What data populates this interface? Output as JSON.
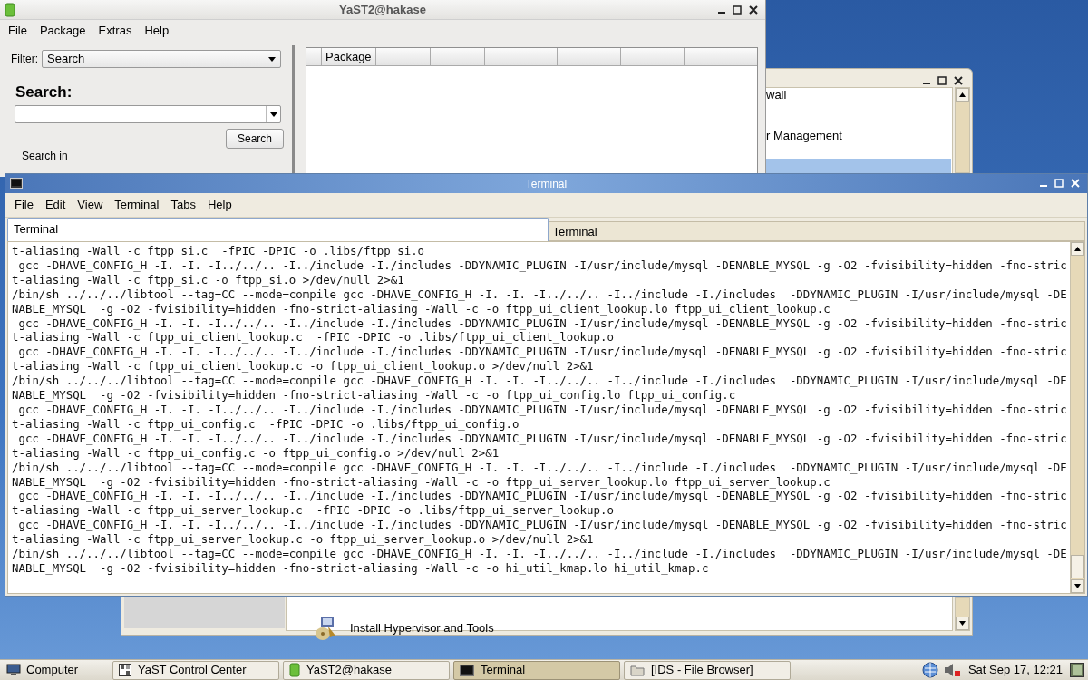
{
  "yast2_window": {
    "title": "YaST2@hakase",
    "menu": [
      "File",
      "Package",
      "Extras",
      "Help"
    ],
    "filter_label": "Filter:",
    "filter_value": "Search",
    "search_heading": "Search:",
    "search_button": "Search",
    "search_in_label": "Search in",
    "table_columns": [
      "Package"
    ]
  },
  "control_center_window": {
    "items": [
      "wall",
      "r Management"
    ],
    "bottom_item": "Install Hypervisor and Tools"
  },
  "terminal_window": {
    "title": "Terminal",
    "menu": [
      "File",
      "Edit",
      "View",
      "Terminal",
      "Tabs",
      "Help"
    ],
    "tabs": [
      {
        "label": "Terminal",
        "selected": true
      },
      {
        "label": "Terminal",
        "selected": false
      }
    ],
    "lines": [
      "t-aliasing -Wall -c ftpp_si.c  -fPIC -DPIC -o .libs/ftpp_si.o",
      " gcc -DHAVE_CONFIG_H -I. -I. -I../../.. -I../include -I./includes -DDYNAMIC_PLUGIN -I/usr/include/mysql -DENABLE_MYSQL -g -O2 -fvisibility=hidden -fno-stric",
      "t-aliasing -Wall -c ftpp_si.c -o ftpp_si.o >/dev/null 2>&1",
      "/bin/sh ../../../libtool --tag=CC --mode=compile gcc -DHAVE_CONFIG_H -I. -I. -I../../.. -I../include -I./includes  -DDYNAMIC_PLUGIN -I/usr/include/mysql -DE",
      "NABLE_MYSQL  -g -O2 -fvisibility=hidden -fno-strict-aliasing -Wall -c -o ftpp_ui_client_lookup.lo ftpp_ui_client_lookup.c",
      " gcc -DHAVE_CONFIG_H -I. -I. -I../../.. -I../include -I./includes -DDYNAMIC_PLUGIN -I/usr/include/mysql -DENABLE_MYSQL -g -O2 -fvisibility=hidden -fno-stric",
      "t-aliasing -Wall -c ftpp_ui_client_lookup.c  -fPIC -DPIC -o .libs/ftpp_ui_client_lookup.o",
      " gcc -DHAVE_CONFIG_H -I. -I. -I../../.. -I../include -I./includes -DDYNAMIC_PLUGIN -I/usr/include/mysql -DENABLE_MYSQL -g -O2 -fvisibility=hidden -fno-stric",
      "t-aliasing -Wall -c ftpp_ui_client_lookup.c -o ftpp_ui_client_lookup.o >/dev/null 2>&1",
      "/bin/sh ../../../libtool --tag=CC --mode=compile gcc -DHAVE_CONFIG_H -I. -I. -I../../.. -I../include -I./includes  -DDYNAMIC_PLUGIN -I/usr/include/mysql -DE",
      "NABLE_MYSQL  -g -O2 -fvisibility=hidden -fno-strict-aliasing -Wall -c -o ftpp_ui_config.lo ftpp_ui_config.c",
      " gcc -DHAVE_CONFIG_H -I. -I. -I../../.. -I../include -I./includes -DDYNAMIC_PLUGIN -I/usr/include/mysql -DENABLE_MYSQL -g -O2 -fvisibility=hidden -fno-stric",
      "t-aliasing -Wall -c ftpp_ui_config.c  -fPIC -DPIC -o .libs/ftpp_ui_config.o",
      " gcc -DHAVE_CONFIG_H -I. -I. -I../../.. -I../include -I./includes -DDYNAMIC_PLUGIN -I/usr/include/mysql -DENABLE_MYSQL -g -O2 -fvisibility=hidden -fno-stric",
      "t-aliasing -Wall -c ftpp_ui_config.c -o ftpp_ui_config.o >/dev/null 2>&1",
      "/bin/sh ../../../libtool --tag=CC --mode=compile gcc -DHAVE_CONFIG_H -I. -I. -I../../.. -I../include -I./includes  -DDYNAMIC_PLUGIN -I/usr/include/mysql -DE",
      "NABLE_MYSQL  -g -O2 -fvisibility=hidden -fno-strict-aliasing -Wall -c -o ftpp_ui_server_lookup.lo ftpp_ui_server_lookup.c",
      " gcc -DHAVE_CONFIG_H -I. -I. -I../../.. -I../include -I./includes -DDYNAMIC_PLUGIN -I/usr/include/mysql -DENABLE_MYSQL -g -O2 -fvisibility=hidden -fno-stric",
      "t-aliasing -Wall -c ftpp_ui_server_lookup.c  -fPIC -DPIC -o .libs/ftpp_ui_server_lookup.o",
      " gcc -DHAVE_CONFIG_H -I. -I. -I../../.. -I../include -I./includes -DDYNAMIC_PLUGIN -I/usr/include/mysql -DENABLE_MYSQL -g -O2 -fvisibility=hidden -fno-stric",
      "t-aliasing -Wall -c ftpp_ui_server_lookup.c -o ftpp_ui_server_lookup.o >/dev/null 2>&1",
      "/bin/sh ../../../libtool --tag=CC --mode=compile gcc -DHAVE_CONFIG_H -I. -I. -I../../.. -I../include -I./includes  -DDYNAMIC_PLUGIN -I/usr/include/mysql -DE",
      "NABLE_MYSQL  -g -O2 -fvisibility=hidden -fno-strict-aliasing -Wall -c -o hi_util_kmap.lo hi_util_kmap.c"
    ]
  },
  "taskbar": {
    "start_label": "Computer",
    "items": [
      {
        "label": "YaST Control Center",
        "kind": "control-center",
        "selected": false
      },
      {
        "label": "YaST2@hakase",
        "kind": "yast",
        "selected": false
      },
      {
        "label": "Terminal",
        "kind": "terminal",
        "selected": true
      },
      {
        "label": "[IDS - File Browser]",
        "kind": "folder",
        "selected": false
      }
    ],
    "clock": "Sat Sep 17, 12:21"
  }
}
